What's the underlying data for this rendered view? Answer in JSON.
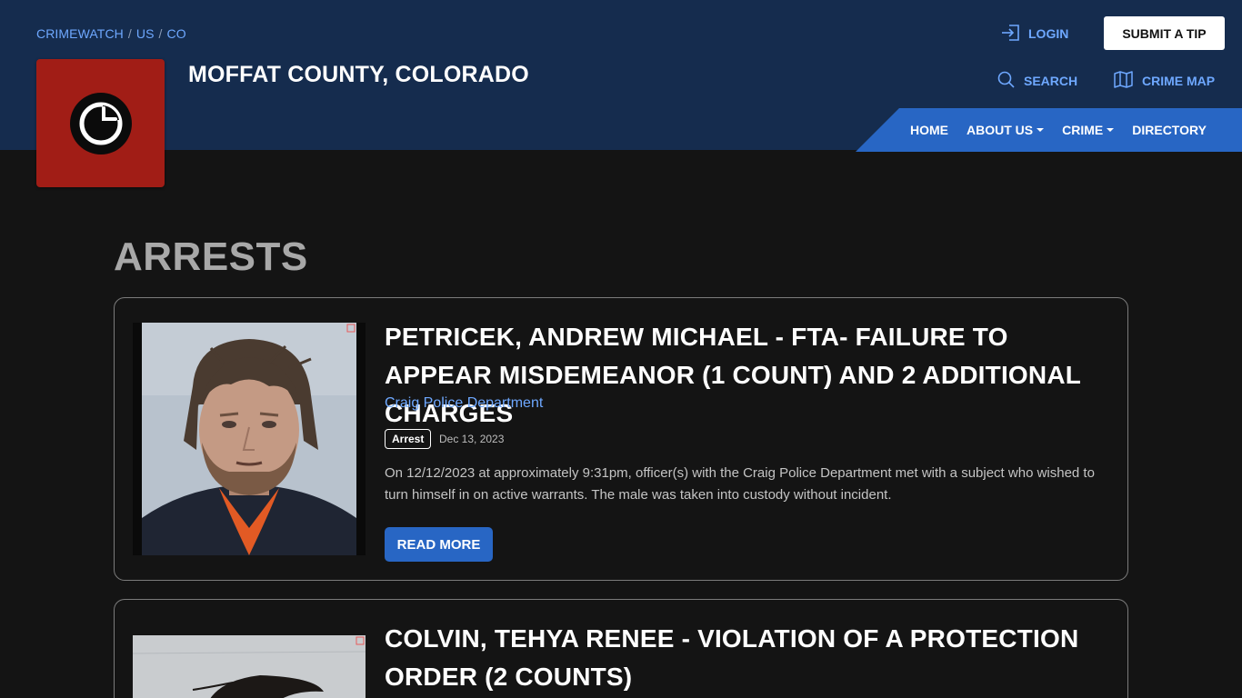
{
  "header": {
    "breadcrumb": [
      "CRIMEWATCH",
      "US",
      "CO"
    ],
    "site_title": "MOFFAT COUNTY, COLORADO",
    "login_label": "LOGIN",
    "submit_tip_label": "SUBMIT A TIP",
    "search_label": "SEARCH",
    "crime_map_label": "CRIME MAP",
    "nav": [
      {
        "label": "HOME",
        "dropdown": false
      },
      {
        "label": "ABOUT US",
        "dropdown": true
      },
      {
        "label": "CRIME",
        "dropdown": true
      },
      {
        "label": "DIRECTORY",
        "dropdown": false
      }
    ],
    "colors": {
      "header_bg": "#152c4e",
      "nav_bg": "#2866c4",
      "logo_bg": "#a11d16",
      "link": "#6ea8ff"
    }
  },
  "page": {
    "title": "ARRESTS"
  },
  "posts": [
    {
      "title": "PETRICEK, ANDREW MICHAEL - FTA- FAILURE TO APPEAR MISDEMEANOR (1 COUNT) AND 2 ADDITIONAL CHARGES",
      "department": "Craig Police Department",
      "tag": "Arrest",
      "date": "Dec 13, 2023",
      "description": "On 12/12/2023 at approximately 9:31pm, officer(s) with the Craig Police Department met with a subject who wished to turn himself in on active warrants. The male was taken into custody without incident.",
      "read_more_label": "READ MORE"
    },
    {
      "title": "COLVIN, TEHYA RENEE - VIOLATION OF A PROTECTION ORDER (2 COUNTS)"
    }
  ]
}
